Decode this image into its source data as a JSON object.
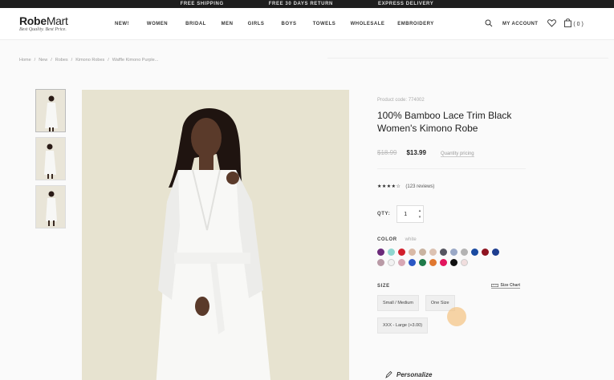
{
  "promo": [
    "FREE SHIPPING",
    "FREE 30 DAYS RETURN",
    "EXPRESS DELIVERY"
  ],
  "brand": {
    "name_part1": "Robe",
    "name_part2": "Mart",
    "tagline": "Best Quality. Best Price."
  },
  "nav": [
    "NEW!",
    "WOMEN",
    "BRIDAL",
    "MEN",
    "GIRLS",
    "BOYS",
    "TOWELS",
    "WHOLESALE",
    "EMBROIDERY"
  ],
  "header": {
    "account": "MY ACCOUNT",
    "cart_count": "( 0 )"
  },
  "breadcrumb": [
    "Home",
    "/",
    "New",
    "/",
    "Robes",
    "/",
    "Kimono Robes",
    "/",
    "Waffle Kimono Purple..."
  ],
  "product": {
    "code": "Product code: 774002",
    "title": "100% Bamboo Lace Trim Black Women's Kimono Robe",
    "old_price": "$18.99",
    "price": "$13.99",
    "quantity_pricing": "Quantity pricing",
    "stars": "★★★★☆",
    "rating": 4,
    "reviews": "(123 reviews)",
    "qty_label": "QTY:",
    "qty_value": "1",
    "color_label": "COLOR",
    "color_value": "white",
    "swatches": [
      "#6b2a7a",
      "#8fd6cf",
      "#d11e2b",
      "#d9b9a6",
      "#c9b3a0",
      "#dcc2b2",
      "#555560",
      "#9aa8c6",
      "#b3b3b3",
      "#1a4aa0",
      "#8e1420",
      "#1d3d8f",
      "#b99aa6",
      "#f2f2f2",
      "#d8a7b4",
      "#2a57c4",
      "#1f7a4a",
      "#e07830",
      "#e2155d",
      "#111111",
      "#f1dede"
    ],
    "size_label": "SIZE",
    "size_chart": "Size Chart",
    "sizes": [
      "Small / Medium",
      "One Size",
      "XXX - Large (+3.00)"
    ],
    "personalize": "Personalize"
  }
}
